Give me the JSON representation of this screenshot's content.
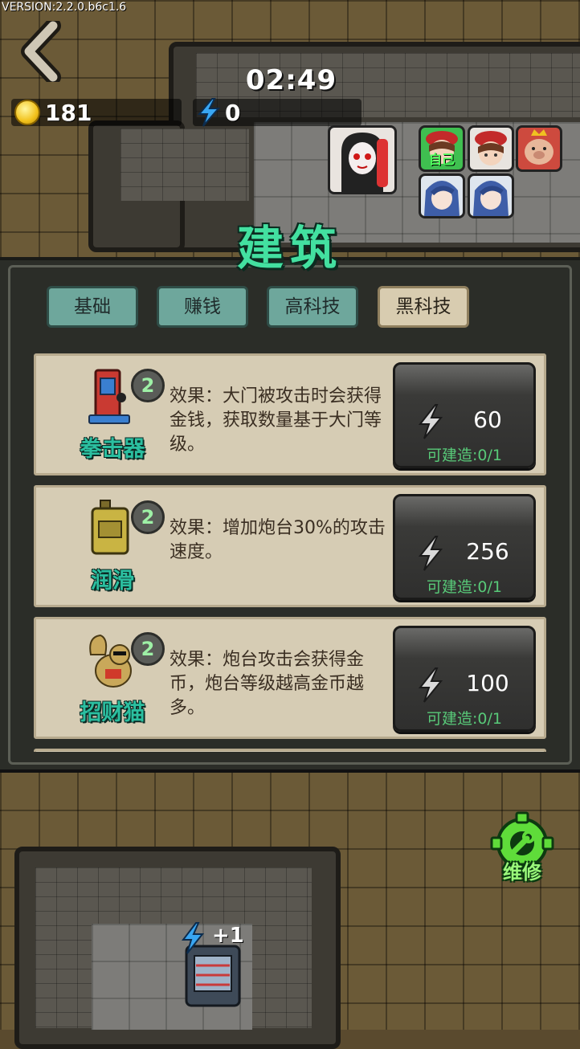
{
  "version": "VERSION:2.2.0.b6c1.6",
  "timer": "02:49",
  "resources": {
    "coins": "181",
    "energy": "0"
  },
  "players": {
    "self_tag": "自己"
  },
  "panel_title": "建筑",
  "tabs": [
    {
      "label": "基础",
      "active": false
    },
    {
      "label": "赚钱",
      "active": false
    },
    {
      "label": "高科技",
      "active": false
    },
    {
      "label": "黑科技",
      "active": true
    }
  ],
  "buildings": [
    {
      "name": "拳击器",
      "level": "2",
      "desc": "效果：大门被攻击时会获得金钱，获取数量基于大门等级。",
      "cost": "60",
      "available": "可建造:0/1",
      "icon": "punching-machine-icon"
    },
    {
      "name": "润滑",
      "level": "2",
      "desc": "效果：增加炮台30%的攻击速度。",
      "cost": "256",
      "available": "可建造:0/1",
      "icon": "oil-can-icon"
    },
    {
      "name": "招财猫",
      "level": "2",
      "desc": "效果：炮台攻击会获得金币，炮台等级越高金币越多。",
      "cost": "100",
      "available": "可建造:0/1",
      "icon": "lucky-cat-icon"
    }
  ],
  "repair_label": "维修",
  "generator_bonus": "+1",
  "colors": {
    "accent": "#43e0a0",
    "available": "#58c978",
    "repair": "#5fdc3a"
  }
}
